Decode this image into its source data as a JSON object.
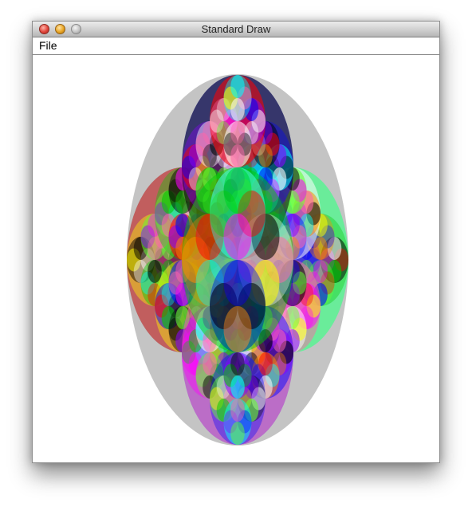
{
  "window": {
    "title": "Standard Draw"
  },
  "menu": {
    "items": [
      "File"
    ]
  },
  "canvas": {
    "background": "#ffffff",
    "colors": {
      "outer_gray": "#c4c4c4",
      "cyan": "#3ff0f0",
      "blue": "#3333ff",
      "palette": [
        "#ff0000",
        "#00cc00",
        "#0000ff",
        "#ffff00",
        "#ff00ff",
        "#00ffff",
        "#ff8800",
        "#8800ff",
        "#000000",
        "#ffffff",
        "#ff66aa",
        "#66ff33"
      ]
    }
  }
}
